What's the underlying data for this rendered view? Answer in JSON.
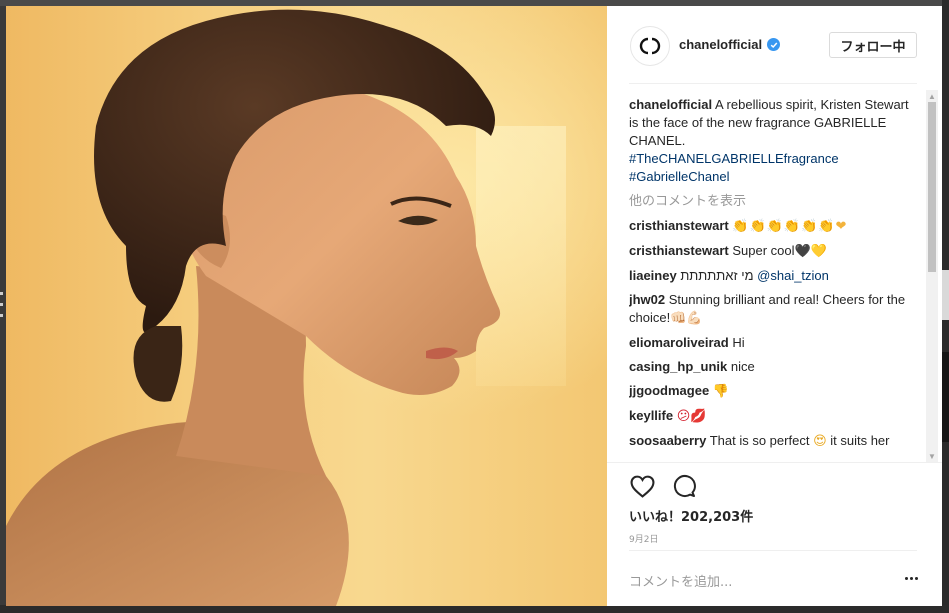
{
  "post": {
    "username": "chanelofficial",
    "follow_label": "フォロー中",
    "caption": {
      "username": "chanelofficial",
      "text": "A rebellious spirit, Kristen Stewart is the face of the new fragrance GABRIELLE CHANEL.",
      "hashtags": [
        "#TheCHANELGABRIELLEfragrance",
        "#GabrielleChanel"
      ]
    },
    "more_comments_label": "他のコメントを表示",
    "comments": [
      {
        "username": "cristhianstewart",
        "text": "",
        "emoji": "👏👏👏👏👏👏❤"
      },
      {
        "username": "cristhianstewart",
        "text": "Super cool",
        "emoji": "🖤💛"
      },
      {
        "username": "liaeiney",
        "text": "מי זאתתתתת",
        "mention": "@shai_tzion"
      },
      {
        "username": "jhw02",
        "text": "Stunning brilliant and real! Cheers for the choice!",
        "emoji": "👊🏻💪🏻"
      },
      {
        "username": "eliomaroliveirad",
        "text": "Hi"
      },
      {
        "username": "casing_hp_unik",
        "text": "nice"
      },
      {
        "username": "jjgoodmagee",
        "text": "",
        "emoji": "👎"
      },
      {
        "username": "keyllife",
        "text": "",
        "emoji": "😕💋"
      },
      {
        "username": "soosaaberry",
        "text": "That is so perfect",
        "emoji": "😍",
        "text_after": "it suits her"
      }
    ],
    "likes_label": "いいね！202,203件",
    "date_label": "9月2日",
    "add_comment_placeholder": "コメントを追加..."
  },
  "icons": {
    "logo": "chanel-logo-icon",
    "verified": "verified-badge-icon",
    "like": "heart-icon",
    "comment": "comment-bubble-icon",
    "more": "more-options-icon"
  },
  "colors": {
    "hashtag": "#003569",
    "verified": "#3897f0",
    "muted": "#999999"
  }
}
